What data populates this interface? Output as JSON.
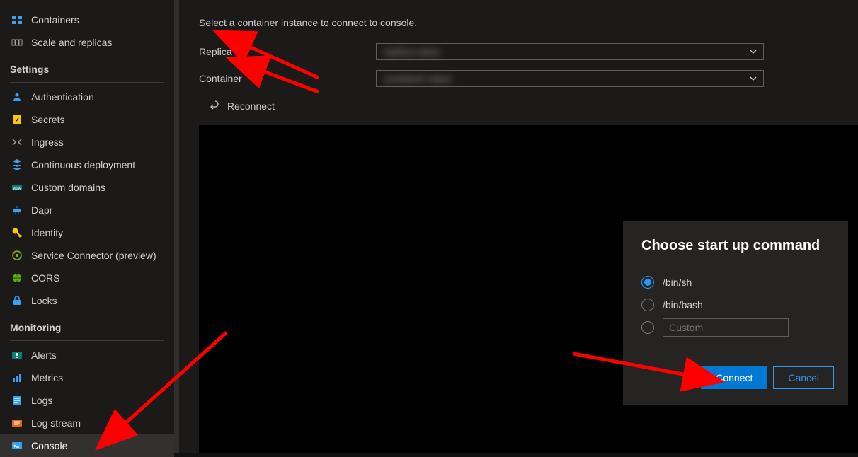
{
  "sidebar": {
    "items_top": [
      {
        "icon": "containers",
        "label": "Containers"
      },
      {
        "icon": "scale",
        "label": "Scale and replicas"
      }
    ],
    "group_settings_label": "Settings",
    "items_settings": [
      {
        "icon": "auth",
        "label": "Authentication"
      },
      {
        "icon": "secrets",
        "label": "Secrets"
      },
      {
        "icon": "ingress",
        "label": "Ingress"
      },
      {
        "icon": "deployment",
        "label": "Continuous deployment"
      },
      {
        "icon": "domains",
        "label": "Custom domains"
      },
      {
        "icon": "dapr",
        "label": "Dapr"
      },
      {
        "icon": "identity",
        "label": "Identity"
      },
      {
        "icon": "service-connector",
        "label": "Service Connector (preview)"
      },
      {
        "icon": "cors",
        "label": "CORS"
      },
      {
        "icon": "locks",
        "label": "Locks"
      }
    ],
    "group_monitoring_label": "Monitoring",
    "items_monitoring": [
      {
        "icon": "alerts",
        "label": "Alerts"
      },
      {
        "icon": "metrics",
        "label": "Metrics"
      },
      {
        "icon": "logs",
        "label": "Logs"
      },
      {
        "icon": "logstream",
        "label": "Log stream"
      },
      {
        "icon": "console",
        "label": "Console",
        "active": true
      }
    ]
  },
  "main": {
    "description": "Select a container instance to connect to console.",
    "replica_label": "Replica",
    "replica_value": "replica-value",
    "container_label": "Container",
    "container_value": "container-value",
    "reconnect_label": "Reconnect"
  },
  "modal": {
    "title": "Choose start up command",
    "options": [
      {
        "value": "/bin/sh",
        "selected": true
      },
      {
        "value": "/bin/bash",
        "selected": false
      }
    ],
    "custom_placeholder": "Custom",
    "connect_label": "Connect",
    "cancel_label": "Cancel"
  }
}
